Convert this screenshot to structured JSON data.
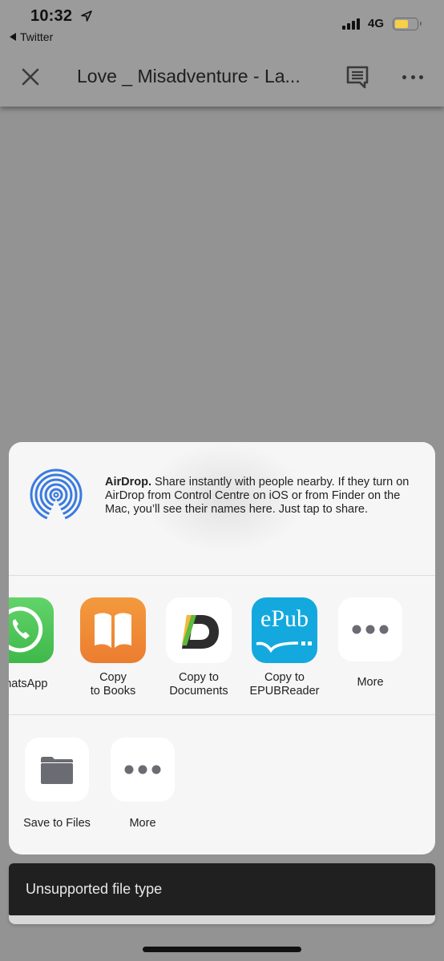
{
  "status_bar": {
    "time": "10:32",
    "back_app": "Twitter",
    "network": "4G",
    "battery_level": 0.6,
    "colors": {
      "battery": "#f5d048"
    }
  },
  "header": {
    "title": "Love _ Misadventure - La...",
    "icons": [
      "close-icon",
      "comment-icon",
      "more-horizontal-icon"
    ]
  },
  "share_sheet": {
    "airdrop": {
      "title": "AirDrop.",
      "description": " Share instantly with people nearby. If they turn on AirDrop from Control Centre on iOS or from Finder on the Mac, you’ll see their names here. Just tap to share.",
      "icon": "airdrop-icon",
      "color": "#3a7be0"
    },
    "apps": [
      {
        "label": "WhatsApp",
        "icon": "whatsapp-icon",
        "color": "#4fc456"
      },
      {
        "label_line1": "Copy",
        "label_line2": "to Books",
        "icon": "books-icon",
        "color": "#f08a32"
      },
      {
        "label_line1": "Copy to",
        "label_line2": "Documents",
        "icon": "documents-icon",
        "color": "#ffffff"
      },
      {
        "label_line1": "Copy to",
        "label_line2": "EPUBReader",
        "icon": "epub-reader-icon",
        "icon_text": "ePub",
        "color": "#13a9de"
      },
      {
        "label": "More",
        "icon": "more-icon"
      }
    ],
    "actions": [
      {
        "label": "Save to Files",
        "icon": "folder-icon"
      },
      {
        "label": "More",
        "icon": "more-icon"
      }
    ]
  },
  "toast": {
    "message": "Unsupported file type"
  }
}
